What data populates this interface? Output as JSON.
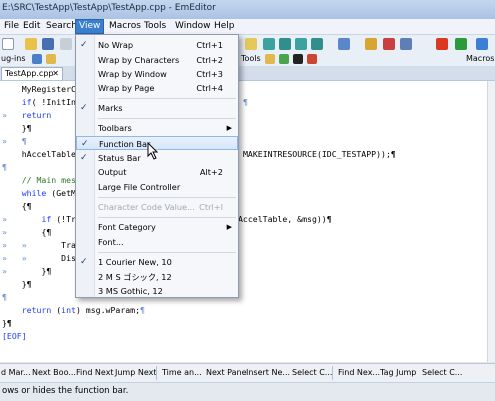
{
  "window": {
    "title": "E:\\SRC\\TestApp\\TestApp\\TestApp.cpp - EmEditor"
  },
  "menubar": [
    "File",
    "Edit",
    "Search",
    "View",
    "Macros",
    "Tools",
    "Window",
    "Help"
  ],
  "toolbar2": {
    "plugins_label": "ug-ins",
    "tools_label": "Tools",
    "macros_label": "Macros"
  },
  "tab": {
    "label": "TestApp.cpp",
    "close": "✕"
  },
  "code": {
    "l1": "MyRegisterC",
    "l2a": "if( !InitIn",
    "l2b": "¶",
    "l3": "return",
    "l4": "}¶",
    "l5": "¶",
    "l6a": "hAccelTable",
    "l6b": "MAKEINTRESOURCE(IDC_TESTAPP));¶",
    "l7": "¶",
    "l8": "// Main mes",
    "l9": "while (GetM",
    "l10": "{¶",
    "l11a": "if (!Tr",
    "l11b": "AccelTable, &msg))¶",
    "l12": "{¶",
    "l13": "Tra",
    "l14": "Dis",
    "l15": "}¶",
    "l16": "}¶",
    "l17": "¶",
    "l18": "return (int) msg.wParam;¶",
    "l19": "}¶",
    "l20": "[EOF]"
  },
  "view_menu": {
    "no_wrap": "No Wrap",
    "no_wrap_sc": "Ctrl+1",
    "wrap_chars": "Wrap by Characters",
    "wrap_chars_sc": "Ctrl+2",
    "wrap_window": "Wrap by Window",
    "wrap_window_sc": "Ctrl+3",
    "wrap_page": "Wrap by Page",
    "wrap_page_sc": "Ctrl+4",
    "marks": "Marks",
    "toolbars": "Toolbars",
    "function_bar": "Function Bar",
    "status_bar": "Status Bar",
    "output": "Output",
    "output_sc": "Alt+2",
    "large_file": "Large File Controller",
    "char_code": "Character Code Value...",
    "char_code_sc": "Ctrl+I",
    "font_category": "Font Category",
    "font": "Font...",
    "recent1": "1 Courier New, 10",
    "recent2": "2 M S ゴシック, 12",
    "recent3": "3 MS Gothic, 12"
  },
  "function_bar": [
    "d Mar...",
    "Next Boo...",
    "Find Next",
    "Jump Next",
    "Time an...",
    "Next Pane",
    "Insert Ne...",
    "Select C...",
    "Find Nex...",
    "Tag Jump",
    "Select C..."
  ],
  "status": {
    "text": "ows or hides the function bar."
  },
  "colors": {
    "keyword": "#1a3cff",
    "comment": "#2c7a2c",
    "highlight": "#d6e6fb",
    "menu_active": "#3a7fd0"
  }
}
